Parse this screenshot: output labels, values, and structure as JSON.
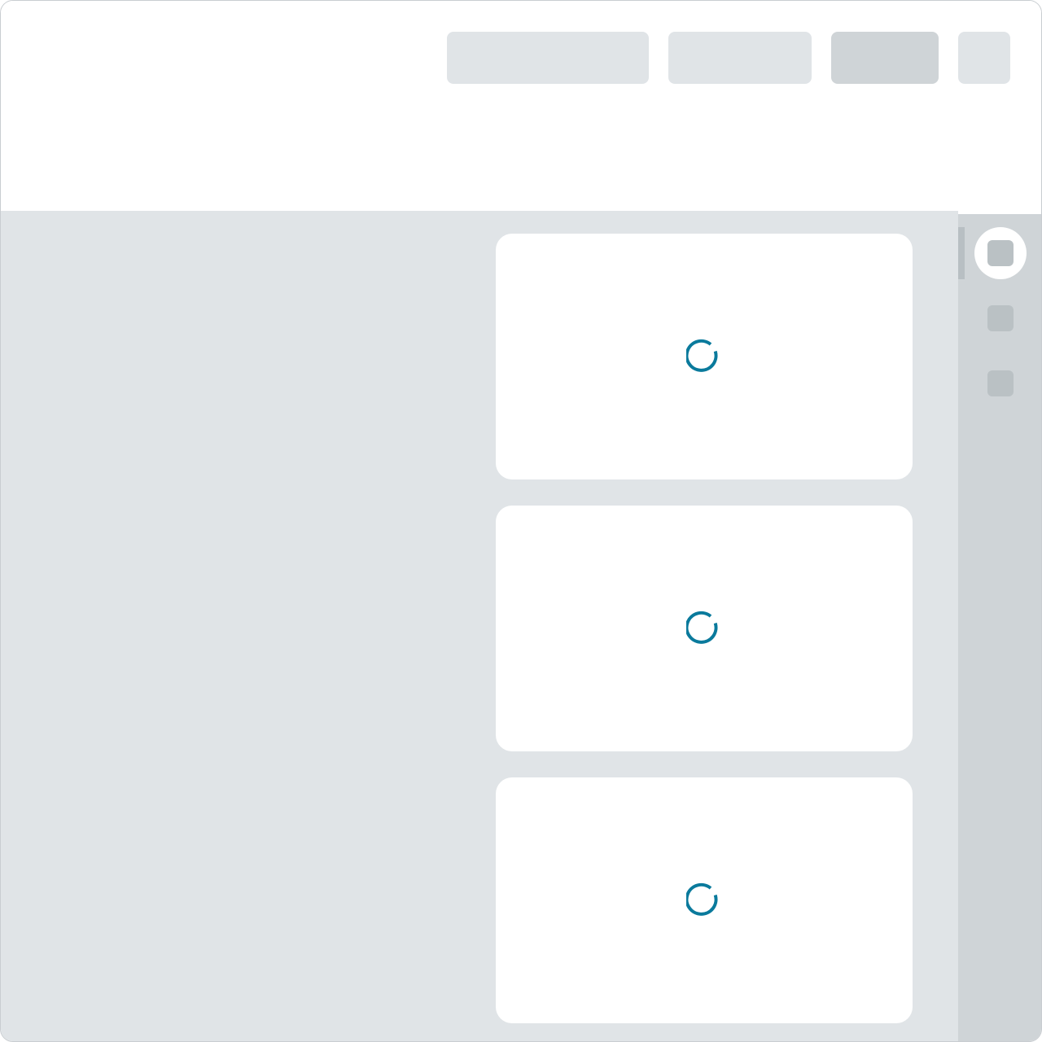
{
  "colors": {
    "header_background": "#ffffff",
    "content_background": "#e0e4e7",
    "skeleton_placeholder": "#e0e4e7",
    "skeleton_placeholder_dark": "#cfd4d7",
    "rail_background": "#cfd4d7",
    "card_background": "#ffffff",
    "spinner_accent": "#0a7a9c"
  },
  "header": {
    "placeholders": [
      {
        "icon": "skeleton-placeholder"
      },
      {
        "icon": "skeleton-placeholder"
      },
      {
        "icon": "skeleton-placeholder"
      },
      {
        "icon": "skeleton-placeholder"
      }
    ]
  },
  "main": {
    "cards": [
      {
        "state": "loading",
        "icon": "loading-spinner-icon"
      },
      {
        "state": "loading",
        "icon": "loading-spinner-icon"
      },
      {
        "state": "loading",
        "icon": "loading-spinner-icon"
      }
    ]
  },
  "rail": {
    "items": [
      {
        "icon": "rail-item-icon",
        "active": true
      },
      {
        "icon": "rail-item-icon",
        "active": false
      },
      {
        "icon": "rail-item-icon",
        "active": false
      }
    ]
  }
}
